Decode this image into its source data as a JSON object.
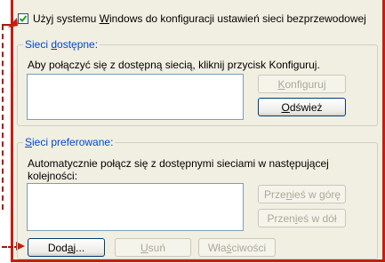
{
  "use_windows_checkbox": {
    "checked": true,
    "label_pre": "Użyj systemu ",
    "label_mnemonic": "W",
    "label_post": "indows do konfiguracji ustawień sieci bezprzewodowej"
  },
  "available": {
    "legend_pre": "Sieci ",
    "legend_mnemonic": "d",
    "legend_post": "ostępne:",
    "description": "Aby połączyć się z dostępną siecią, kliknij przycisk Konfiguruj.",
    "configure_pre": "",
    "configure_mnemonic": "K",
    "configure_post": "onfiguruj",
    "refresh_pre": "",
    "refresh_mnemonic": "O",
    "refresh_post": "dśwież"
  },
  "preferred": {
    "legend_pre": "",
    "legend_mnemonic": "S",
    "legend_post": "ieci preferowane:",
    "description": "Automatycznie połącz się z dostępnymi sieciami w następującej kolejności:",
    "move_up_pre": "Prze",
    "move_up_mnemonic": "n",
    "move_up_post": "ieś w górę",
    "move_down_pre": "Przen",
    "move_down_mnemonic": "i",
    "move_down_post": "eś w dół",
    "add_pre": "Dod",
    "add_mnemonic": "a",
    "add_post": "j...",
    "remove_pre": "",
    "remove_mnemonic": "U",
    "remove_post": "suń",
    "properties_pre": "Wła",
    "properties_mnemonic": "ś",
    "properties_post": "ciwości"
  },
  "colors": {
    "annotation": "#c81d11",
    "legend": "#0046d5",
    "panel": "#f1efe2"
  }
}
